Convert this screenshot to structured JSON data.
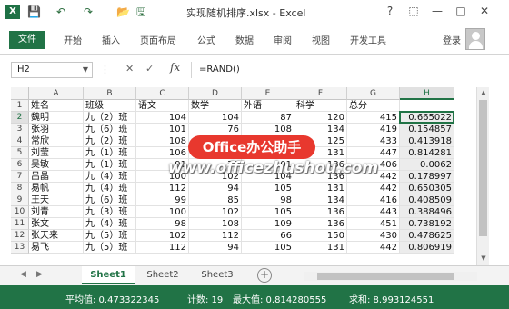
{
  "titlebar": {
    "logo_text": "X",
    "title": "实现随机排序.xlsx - Excel",
    "help": "?",
    "restore": "⬚",
    "minimize": "—",
    "maximize": "□",
    "close": "✕"
  },
  "quick_access": [
    "💾",
    "↶",
    "↷",
    "📂",
    "🖫"
  ],
  "ribbon": {
    "file_tab": "文件",
    "tabs": [
      "开始",
      "插入",
      "页面布局",
      "公式",
      "数据",
      "审阅",
      "视图",
      "开发工具"
    ],
    "login": "登录"
  },
  "formula_bar": {
    "name_box": "H2",
    "fx": "fx",
    "formula": "=RAND()"
  },
  "grid": {
    "column_headers": [
      "A",
      "B",
      "C",
      "D",
      "E",
      "F",
      "G",
      "H"
    ],
    "selected_column": "H",
    "active_cell": "H2",
    "row_numbers": [
      "1",
      "2",
      "3",
      "4",
      "5",
      "6",
      "7",
      "8",
      "9",
      "10",
      "11",
      "12",
      "13"
    ],
    "rows": [
      [
        "姓名",
        "班级",
        "语文",
        "数学",
        "外语",
        "科学",
        "总分",
        ""
      ],
      [
        "魏明",
        "九（2）班",
        "104",
        "104",
        "87",
        "120",
        "415",
        "0.665022"
      ],
      [
        "张羽",
        "九（6）班",
        "101",
        "76",
        "108",
        "134",
        "419",
        "0.154857"
      ],
      [
        "常欣",
        "九（2）班",
        "108",
        "96",
        "104",
        "125",
        "433",
        "0.413918"
      ],
      [
        "刘莹",
        "九（1）班",
        "106",
        "112",
        "98",
        "131",
        "447",
        "0.814281"
      ],
      [
        "吴敏",
        "九（1）班",
        "91",
        "78",
        "101",
        "136",
        "406",
        "0.0062"
      ],
      [
        "吕晶",
        "九（4）班",
        "100",
        "102",
        "104",
        "136",
        "442",
        "0.178997"
      ],
      [
        "易帆",
        "九（4）班",
        "112",
        "94",
        "105",
        "131",
        "442",
        "0.650305"
      ],
      [
        "王天",
        "九（6）班",
        "99",
        "85",
        "98",
        "134",
        "416",
        "0.408509"
      ],
      [
        "刘青",
        "九（3）班",
        "100",
        "102",
        "105",
        "136",
        "443",
        "0.388496"
      ],
      [
        "张文",
        "九（4）班",
        "98",
        "108",
        "109",
        "136",
        "451",
        "0.738192"
      ],
      [
        "张天来",
        "九（5）班",
        "102",
        "112",
        "66",
        "150",
        "430",
        "0.478625"
      ],
      [
        "易飞",
        "九（5）班",
        "112",
        "94",
        "105",
        "131",
        "442",
        "0.806919"
      ]
    ]
  },
  "sheets": {
    "tabs": [
      "Sheet1",
      "Sheet2",
      "Sheet3"
    ],
    "active": "Sheet1",
    "add": "+",
    "nav_prev": "◀",
    "nav_next": "▶"
  },
  "status": {
    "average": "平均值: 0.473322345",
    "count": "计数: 19",
    "max": "最大值: 0.814280555",
    "sum": "求和: 8.993124551"
  },
  "watermark": {
    "badge": "Office办公助手",
    "url": "www.officezhushou.com"
  },
  "colors": {
    "excel_green": "#217346",
    "status_bar": "#217346",
    "watermark_red": "#e8382e"
  }
}
